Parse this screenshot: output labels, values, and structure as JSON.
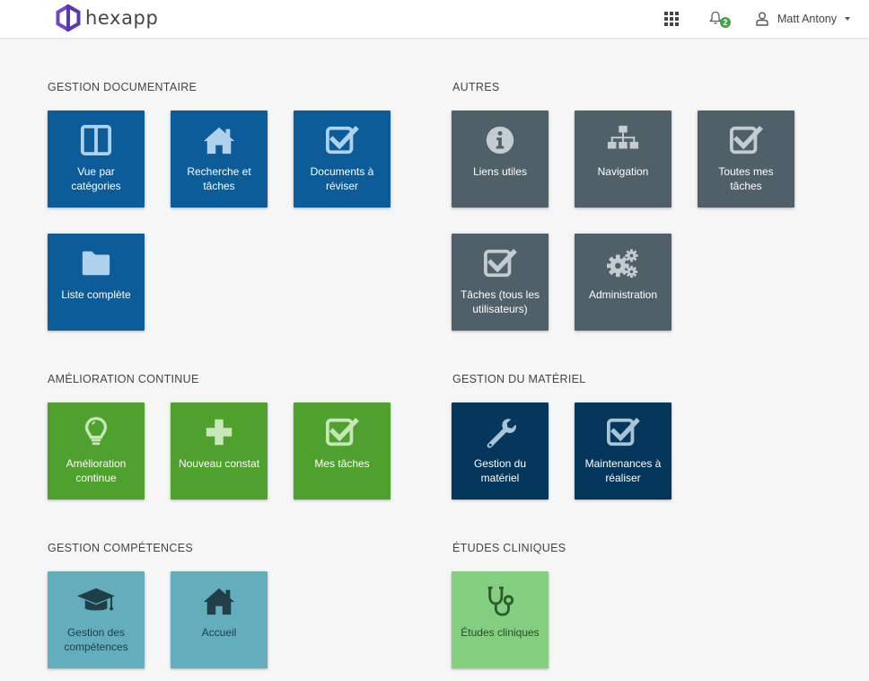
{
  "header": {
    "logo_text": "hexapp",
    "notification_count": "2",
    "user_name": "Matt Antony"
  },
  "sections": {
    "gestion_documentaire": {
      "title": "GESTION DOCUMENTAIRE",
      "tiles": [
        {
          "label": "Vue par catégories",
          "icon": "columns-icon"
        },
        {
          "label": "Recherche et tâches",
          "icon": "home-icon"
        },
        {
          "label": "Documents à réviser",
          "icon": "check-square-icon"
        },
        {
          "label": "Liste complète",
          "icon": "folder-icon"
        }
      ]
    },
    "autres": {
      "title": "AUTRES",
      "tiles": [
        {
          "label": "Liens utiles",
          "icon": "info-circle-icon"
        },
        {
          "label": "Navigation",
          "icon": "sitemap-icon"
        },
        {
          "label": "Toutes mes tâches",
          "icon": "check-square-icon"
        },
        {
          "label": "Tâches (tous les utilisateurs)",
          "icon": "check-square-icon"
        },
        {
          "label": "Administration",
          "icon": "gears-icon"
        }
      ]
    },
    "amelioration_continue": {
      "title": "AMÉLIORATION CONTINUE",
      "tiles": [
        {
          "label": "Amélioration continue",
          "icon": "lightbulb-icon"
        },
        {
          "label": "Nouveau constat",
          "icon": "plus-icon"
        },
        {
          "label": "Mes tâches",
          "icon": "check-square-icon"
        }
      ]
    },
    "gestion_materiel": {
      "title": "GESTION DU MATÉRIEL",
      "tiles": [
        {
          "label": "Gestion du matériel",
          "icon": "wrench-icon"
        },
        {
          "label": "Maintenances à réaliser",
          "icon": "check-square-icon"
        }
      ]
    },
    "gestion_competences": {
      "title": "GESTION COMPÉTENCES",
      "tiles": [
        {
          "label": "Gestion des compétences",
          "icon": "graduation-cap-icon"
        },
        {
          "label": "Accueil",
          "icon": "home-icon"
        }
      ]
    },
    "etudes_cliniques": {
      "title": "ÉTUDES CLINIQUES",
      "tiles": [
        {
          "label": "Études cliniques",
          "icon": "stethoscope-icon"
        }
      ]
    }
  },
  "colors": {
    "documentaire": "#0b5c99",
    "autres": "#4f6069",
    "amelioration": "#4ea12d",
    "materiel": "#04375b",
    "competences": "#63adbd",
    "etudes": "#84cf7f"
  }
}
